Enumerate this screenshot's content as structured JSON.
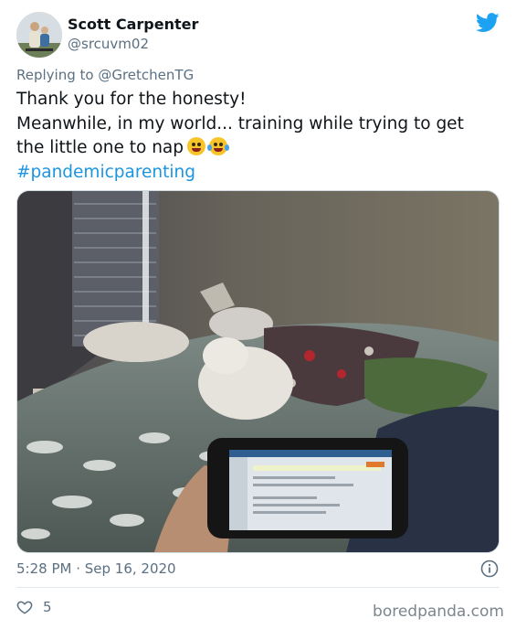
{
  "user": {
    "display_name": "Scott Carpenter",
    "handle": "@srcuvm02"
  },
  "reply": {
    "prefix": "Replying to ",
    "mention": "@GretchenTG"
  },
  "tweet": {
    "line1": "Thank you for the honesty!",
    "line2": "Meanwhile, in my world... training while trying to get",
    "line3": "the little one to nap",
    "hashtag": "#pandemicparenting",
    "emojis": [
      "zany-face",
      "face-with-tears-of-joy"
    ]
  },
  "meta": {
    "timestamp": "5:28 PM · Sep 16, 2020",
    "likes": "5"
  },
  "watermark": "boredpanda.com",
  "colors": {
    "twitter_blue": "#1da1f2",
    "link": "#1b95e0",
    "secondary_text": "#5b7083",
    "like_red": "#e0245e"
  },
  "icons": [
    "twitter-bird-icon",
    "info-icon",
    "heart-icon"
  ]
}
